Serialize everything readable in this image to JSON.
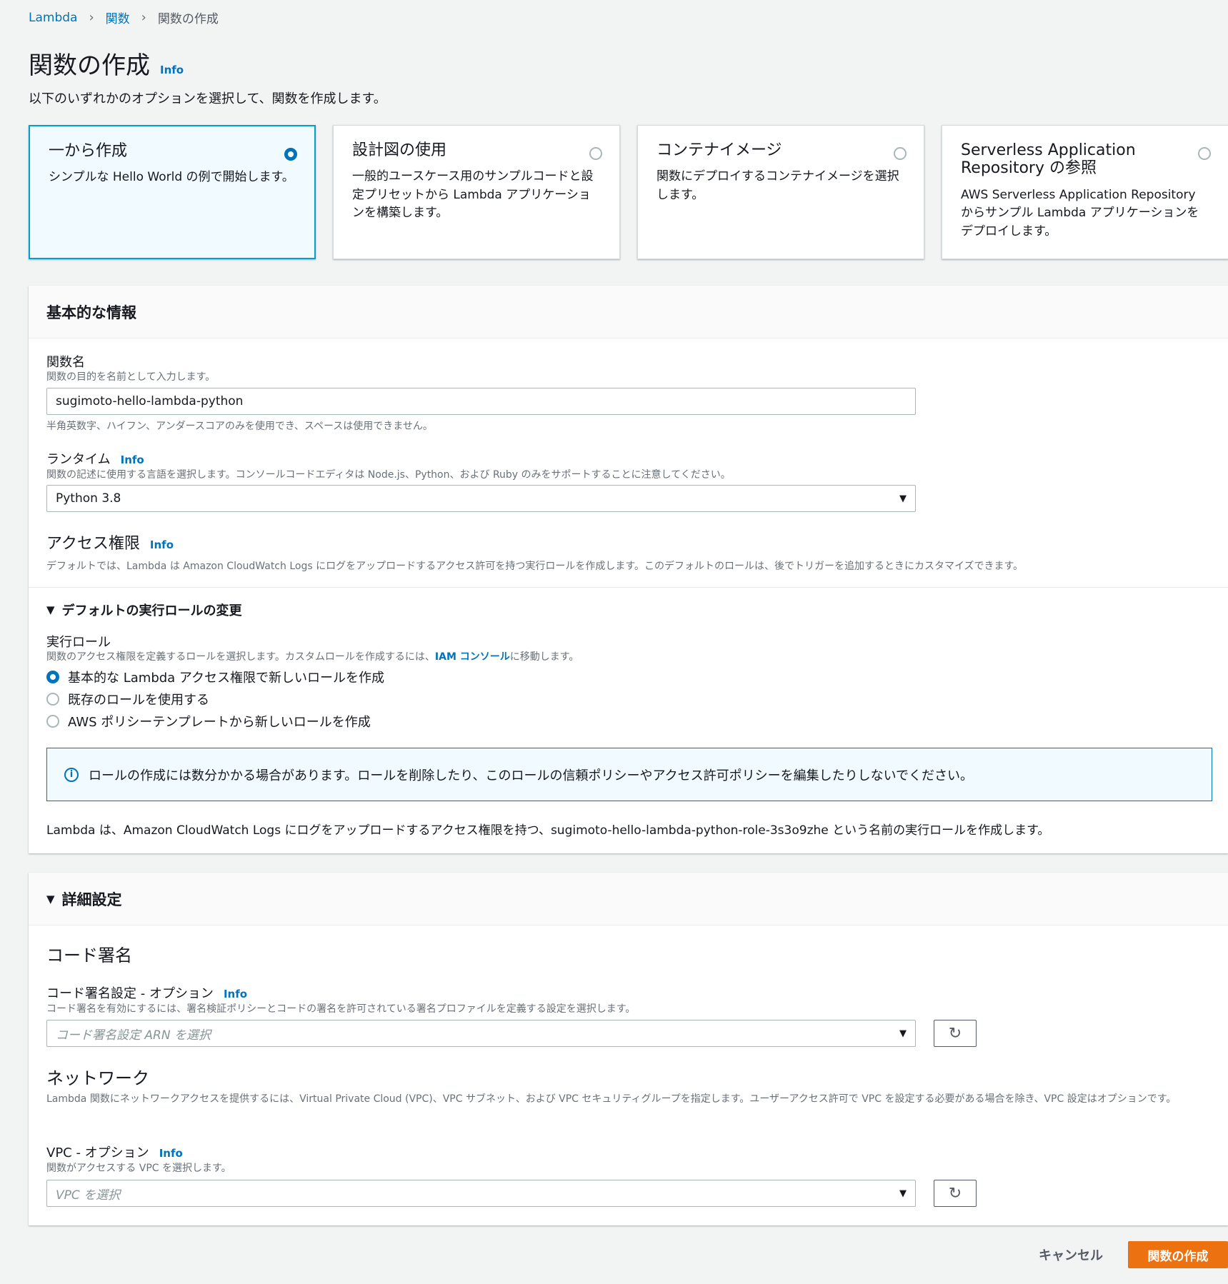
{
  "breadcrumb": {
    "items": [
      "Lambda",
      "関数"
    ],
    "current": "関数の作成"
  },
  "page": {
    "title": "関数の作成",
    "info": "Info",
    "description": "以下のいずれかのオプションを選択して、関数を作成します。"
  },
  "options": [
    {
      "title": "一から作成",
      "desc": "シンプルな Hello World の例で開始します。",
      "selected": true
    },
    {
      "title": "設計図の使用",
      "desc": "一般的ユースケース用のサンプルコードと設定プリセットから Lambda アプリケーションを構築します。",
      "selected": false
    },
    {
      "title": "コンテナイメージ",
      "desc": "関数にデプロイするコンテナイメージを選択します。",
      "selected": false
    },
    {
      "title": "Serverless Application Repository の参照",
      "desc": "AWS Serverless Application Repository からサンプル Lambda アプリケーションをデプロイします。",
      "selected": false
    }
  ],
  "basic": {
    "header": "基本的な情報",
    "function_name": {
      "label": "関数名",
      "desc": "関数の目的を名前として入力します。",
      "value": "sugimoto-hello-lambda-python",
      "hint": "半角英数字、ハイフン、アンダースコアのみを使用でき、スペースは使用できません。"
    },
    "runtime": {
      "label": "ランタイム",
      "info": "Info",
      "desc": "関数の記述に使用する言語を選択します。コンソールコードエディタは Node.js、Python、および Ruby のみをサポートすることに注意してください。",
      "value": "Python 3.8"
    },
    "permissions": {
      "label": "アクセス権限",
      "info": "Info",
      "desc": "デフォルトでは、Lambda は Amazon CloudWatch Logs にログをアップロードするアクセス許可を持つ実行ロールを作成します。このデフォルトのロールは、後でトリガーを追加するときにカスタマイズできます。"
    },
    "role_toggle": "デフォルトの実行ロールの変更",
    "exec_role": {
      "label": "実行ロール",
      "desc_pre": "関数のアクセス権限を定義するロールを選択します。カスタムロールを作成するには、",
      "desc_link": "IAM コンソール",
      "desc_post": "に移動します。",
      "options": [
        "基本的な Lambda アクセス権限で新しいロールを作成",
        "既存のロールを使用する",
        "AWS ポリシーテンプレートから新しいロールを作成"
      ],
      "selected_index": 0
    },
    "alert": "ロールの作成には数分かかる場合があります。ロールを削除したり、このロールの信頼ポリシーやアクセス許可ポリシーを編集したりしないでください。",
    "role_note": "Lambda は、Amazon CloudWatch Logs にログをアップロードするアクセス権限を持つ、sugimoto-hello-lambda-python-role-3s3o9zhe という名前の実行ロールを作成します。"
  },
  "advanced": {
    "header": "詳細設定",
    "code_signing": {
      "title": "コード署名",
      "label": "コード署名設定 - オプション",
      "info": "Info",
      "desc": "コード署名を有効にするには、署名検証ポリシーとコードの署名を許可されている署名プロファイルを定義する設定を選択します。",
      "placeholder": "コード署名設定 ARN を選択"
    },
    "network": {
      "title": "ネットワーク",
      "desc": "Lambda 関数にネットワークアクセスを提供するには、Virtual Private Cloud (VPC)、VPC サブネット、および VPC セキュリティグループを指定します。ユーザーアクセス許可で VPC を設定する必要がある場合を除き、VPC 設定はオプションです。"
    },
    "vpc": {
      "label": "VPC - オプション",
      "info": "Info",
      "desc": "関数がアクセスする VPC を選択します。",
      "placeholder": "VPC を選択"
    }
  },
  "footer": {
    "cancel": "キャンセル",
    "create": "関数の作成"
  },
  "colors": {
    "accent": "#0073bb",
    "primary_button": "#ec7211",
    "selected_border": "#00a1c9"
  },
  "icons": {
    "refresh": "refresh-icon",
    "info": "info-icon",
    "caret": "caret-down-icon",
    "dropdown": "dropdown-arrow-icon"
  }
}
